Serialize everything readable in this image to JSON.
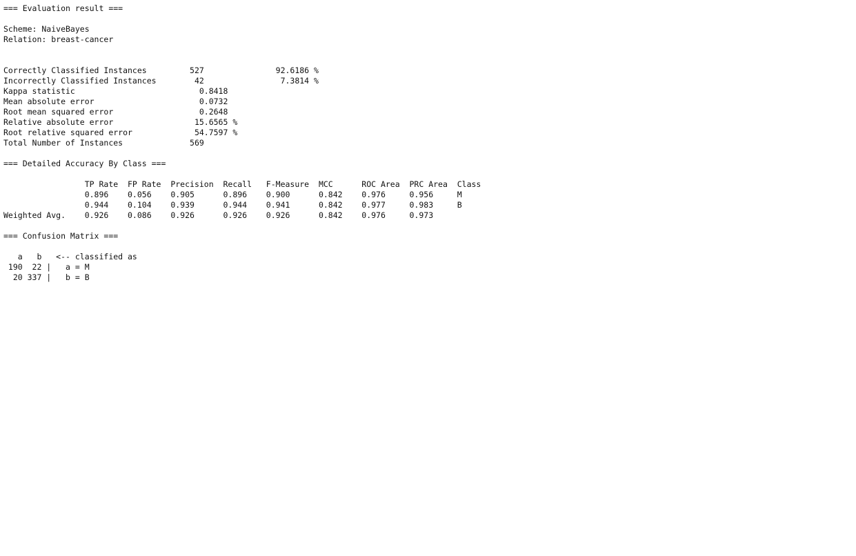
{
  "text_color": "#111111",
  "background": "#ffffff",
  "output_lines": [
    "=== Evaluation result ===",
    "",
    "Scheme: NaiveBayes",
    "Relation: breast-cancer",
    "",
    "",
    "Correctly Classified Instances         527               92.6186 %",
    "Incorrectly Classified Instances        42                7.3814 %",
    "Kappa statistic                          0.8418",
    "Mean absolute error                      0.0732",
    "Root mean squared error                  0.2648",
    "Relative absolute error                 15.6565 %",
    "Root relative squared error             54.7597 %",
    "Total Number of Instances              569",
    "",
    "=== Detailed Accuracy By Class ===",
    "",
    "                 TP Rate  FP Rate  Precision  Recall   F-Measure  MCC      ROC Area  PRC Area  Class",
    "                 0.896    0.056    0.905      0.896    0.900      0.842    0.976     0.956     M",
    "                 0.944    0.104    0.939      0.944    0.941      0.842    0.977     0.983     B",
    "Weighted Avg.    0.926    0.086    0.926      0.926    0.926      0.842    0.976     0.973",
    "",
    "=== Confusion Matrix ===",
    "",
    "   a   b   <-- classified as",
    " 190  22 |   a = M",
    "  20 337 |   b = B"
  ]
}
